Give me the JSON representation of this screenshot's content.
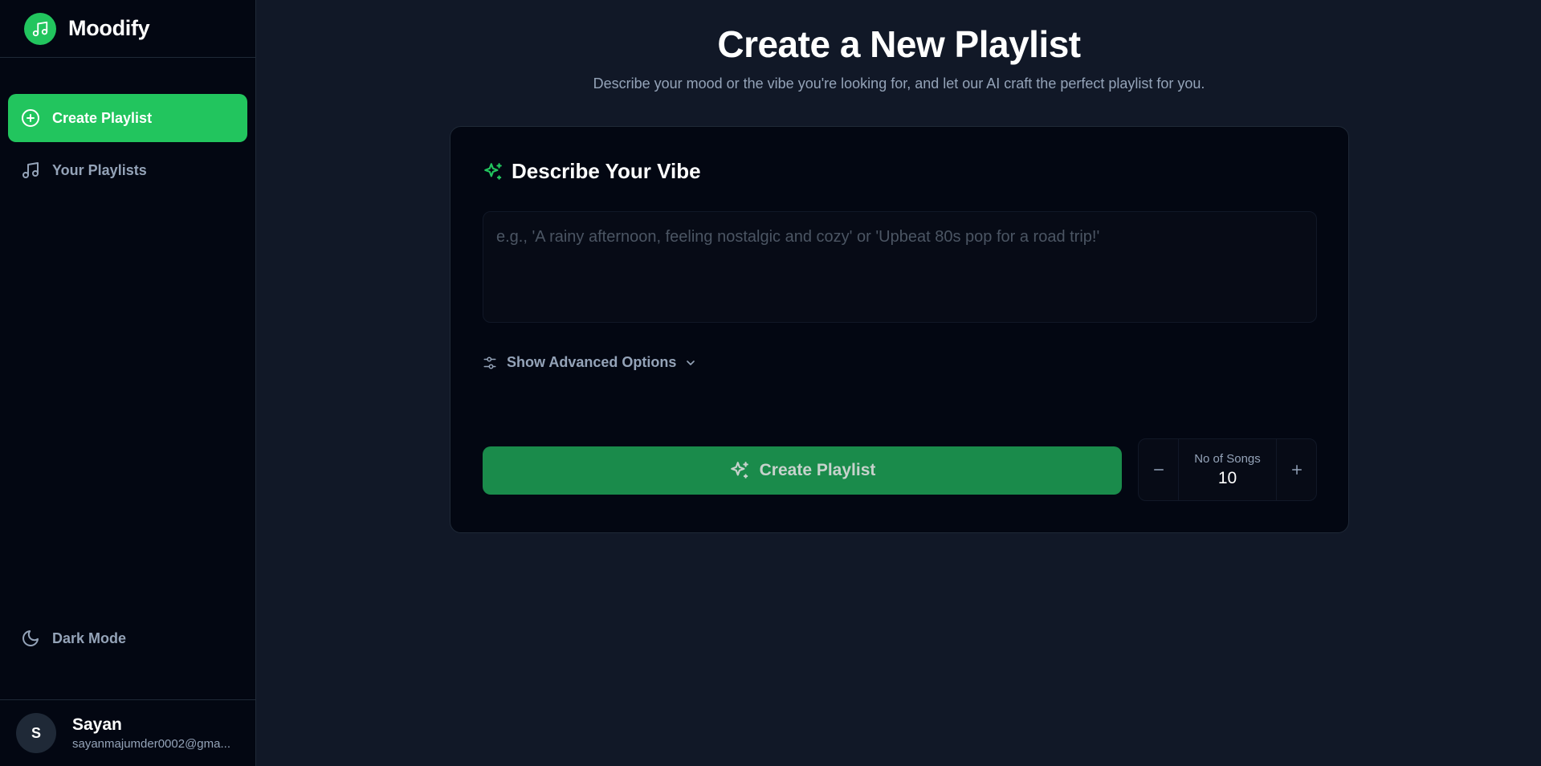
{
  "app": {
    "name": "Moodify"
  },
  "sidebar": {
    "items": [
      {
        "label": "Create Playlist",
        "icon": "plus-circle-icon",
        "active": true
      },
      {
        "label": "Your Playlists",
        "icon": "music-note-icon",
        "active": false
      }
    ],
    "theme_toggle": {
      "label": "Dark Mode",
      "icon": "moon-icon"
    },
    "user": {
      "initial": "S",
      "name": "Sayan",
      "email": "sayanmajumder0002@gma..."
    }
  },
  "main": {
    "title": "Create a New Playlist",
    "subtitle": "Describe your mood or the vibe you're looking for, and let our AI craft the perfect playlist for you.",
    "card": {
      "title": "Describe Your Vibe",
      "title_icon": "sparkles-icon",
      "input_placeholder": "e.g., 'A rainy afternoon, feeling nostalgic and cozy' or 'Upbeat 80s pop for a road trip!'",
      "input_value": "",
      "advanced_label": "Show Advanced Options",
      "create_button_label": "Create Playlist",
      "stepper": {
        "label": "No of Songs",
        "value": "10"
      }
    }
  },
  "colors": {
    "accent": "#22c55e",
    "accent_dim": "#1a8b4b",
    "sidebar_bg": "#030712",
    "main_bg": "#111827",
    "muted_text": "#94a3b8"
  }
}
